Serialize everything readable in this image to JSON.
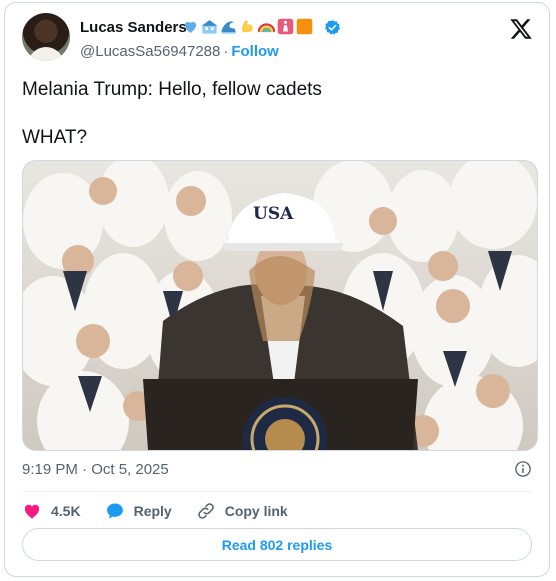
{
  "author": {
    "name": "Lucas Sanders",
    "handle": "@LucasSa56947288",
    "follow_label": "Follow",
    "name_emojis": [
      "blue-heart",
      "rooftop-house",
      "water-wave",
      "flexed-biceps",
      "rainbow",
      "restroom-sign",
      "orange-square"
    ],
    "verified": true
  },
  "brand_icon": "x-logo-icon",
  "tweet": {
    "line1": "Melania Trump: Hello, fellow cadets",
    "line2": "WHAT?",
    "media_cap_text": "USA"
  },
  "meta": {
    "timestamp": "9:19 PM · Oct 5, 2025"
  },
  "actions": {
    "likes": "4.5K",
    "reply_label": "Reply",
    "copy_label": "Copy link"
  },
  "read_replies_label": "Read 802 replies",
  "colors": {
    "accent": "#1d9bf0",
    "like": "#f91880",
    "text": "#0f1419",
    "muted": "#536471",
    "border": "#cfd9de"
  }
}
